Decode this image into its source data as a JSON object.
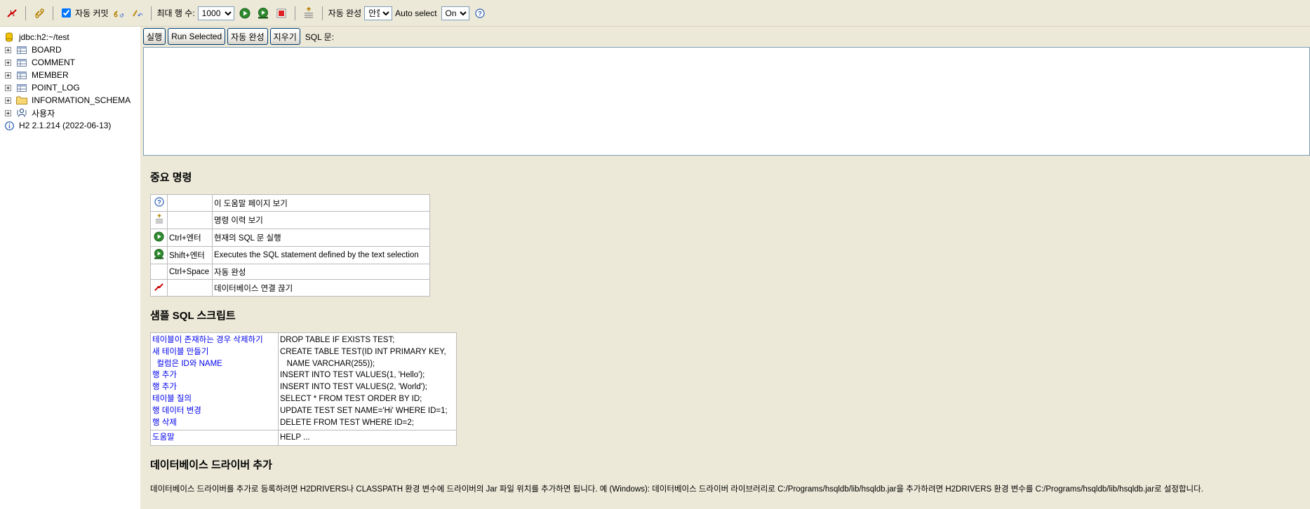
{
  "toolbar": {
    "disconnect_icon": "disconnect-icon",
    "refresh_icon": "refresh-icon",
    "autocommit_label": "자동 커밋",
    "autocommit_checked": true,
    "max_rows_label": "최대 행 수:",
    "max_rows_value": "1000",
    "autocomplete_label": "자동 완성",
    "autocomplete_value": "안함",
    "autoselect_label": "Auto select",
    "autoselect_value": "On"
  },
  "tree": {
    "connection": "jdbc:h2:~/test",
    "tables": [
      "BOARD",
      "COMMENT",
      "MEMBER",
      "POINT_LOG"
    ],
    "schema": "INFORMATION_SCHEMA",
    "users": "사용자",
    "version": "H2 2.1.214 (2022-06-13)"
  },
  "main": {
    "buttons": {
      "run": "실행",
      "run_selected": "Run Selected",
      "autocomplete": "자동 완성",
      "clear": "지우기"
    },
    "sql_label": "SQL 문:",
    "sql_value": ""
  },
  "help": {
    "important_title": "중요 명령",
    "commands": [
      {
        "icon": "help-icon",
        "key": "",
        "desc": "이 도움말 페이지 보기"
      },
      {
        "icon": "history-icon",
        "key": "",
        "desc": "명령 이력 보기"
      },
      {
        "icon": "run-icon",
        "key": "Ctrl+엔터",
        "desc": "현재의 SQL 문 실행"
      },
      {
        "icon": "run-selected-icon",
        "key": "Shift+엔터",
        "desc": "Executes the SQL statement defined by the text selection"
      },
      {
        "icon": "",
        "key": "Ctrl+Space",
        "desc": "자동 완성"
      },
      {
        "icon": "disconnect-icon",
        "key": "",
        "desc": "데이터베이스 연결 끊기"
      }
    ],
    "sample_title": "샘플 SQL 스크립트",
    "samples": [
      {
        "label": "테이블이 존재하는 경우 삭제하기",
        "sql": "DROP TABLE IF EXISTS TEST;"
      },
      {
        "label": "새 테이블 만들기",
        "sql": "CREATE TABLE TEST(ID INT PRIMARY KEY,"
      },
      {
        "label": "  컬럼은 ID와 NAME",
        "sql": "   NAME VARCHAR(255));"
      },
      {
        "label": "행 추가",
        "sql": "INSERT INTO TEST VALUES(1, 'Hello');"
      },
      {
        "label": "행 추가",
        "sql": "INSERT INTO TEST VALUES(2, 'World');"
      },
      {
        "label": "테이블 질의",
        "sql": "SELECT * FROM TEST ORDER BY ID;"
      },
      {
        "label": "행 데이터 변경",
        "sql": "UPDATE TEST SET NAME='Hi' WHERE ID=1;"
      },
      {
        "label": "행 삭제",
        "sql": "DELETE FROM TEST WHERE ID=2;"
      }
    ],
    "help_row": {
      "label": "도움말",
      "sql": "HELP ..."
    },
    "driver_title": "데이터베이스 드라이버 추가",
    "driver_text": "데이터베이스 드라이버를 추가로 등록하려면 H2DRIVERS나 CLASSPATH 환경 변수에 드라이버의 Jar 파일 위치를 추가하면 됩니다. 예 (Windows): 데이터베이스 드라이버 라이브러리로 C:/Programs/hsqldb/lib/hsqldb.jar을 추가하려면 H2DRIVERS 환경 변수를 C:/Programs/hsqldb/lib/hsqldb.jar로 설정합니다."
  }
}
